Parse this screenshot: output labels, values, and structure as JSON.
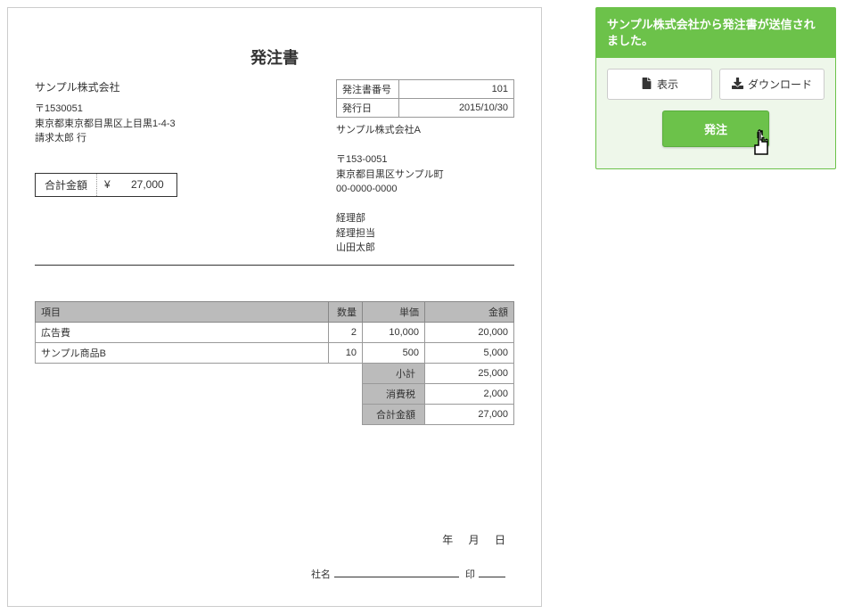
{
  "doc": {
    "title": "発注書",
    "recipient": {
      "company": "サンプル株式会社",
      "postal": "〒1530051",
      "address": "東京都東京都目黒区上目黒1-4-3",
      "attention": "請求太郎 行"
    },
    "meta": {
      "order_no_label": "発注書番号",
      "order_no": "101",
      "issue_date_label": "発行日",
      "issue_date": "2015/10/30"
    },
    "issuer": {
      "company": "サンプル株式会社A",
      "postal": "〒153-0051",
      "address": "東京都目黒区サンプル町",
      "phone": "00-0000-0000",
      "dept": "経理部",
      "role": "経理担当",
      "person": "山田太郎"
    },
    "total_box": {
      "label": "合計金額",
      "currency": "¥",
      "amount": "27,000"
    },
    "items_header": {
      "item": "項目",
      "qty": "数量",
      "unit": "単価",
      "amount": "金額"
    },
    "items": [
      {
        "name": "広告費",
        "qty": "2",
        "unit": "10,000",
        "amount": "20,000"
      },
      {
        "name": "サンプル商品B",
        "qty": "10",
        "unit": "500",
        "amount": "5,000"
      }
    ],
    "summary": {
      "subtotal_label": "小計",
      "subtotal": "25,000",
      "tax_label": "消費税",
      "tax": "2,000",
      "total_label": "合計金額",
      "total": "27,000"
    },
    "date_placeholders": [
      "年",
      "月",
      "日"
    ],
    "stamp": {
      "company_label": "社名",
      "seal_label": "印"
    }
  },
  "panel": {
    "message": "サンプル株式会社から発注書が送信されました。",
    "view_label": "表示",
    "download_label": "ダウンロード",
    "order_label": "発注"
  }
}
